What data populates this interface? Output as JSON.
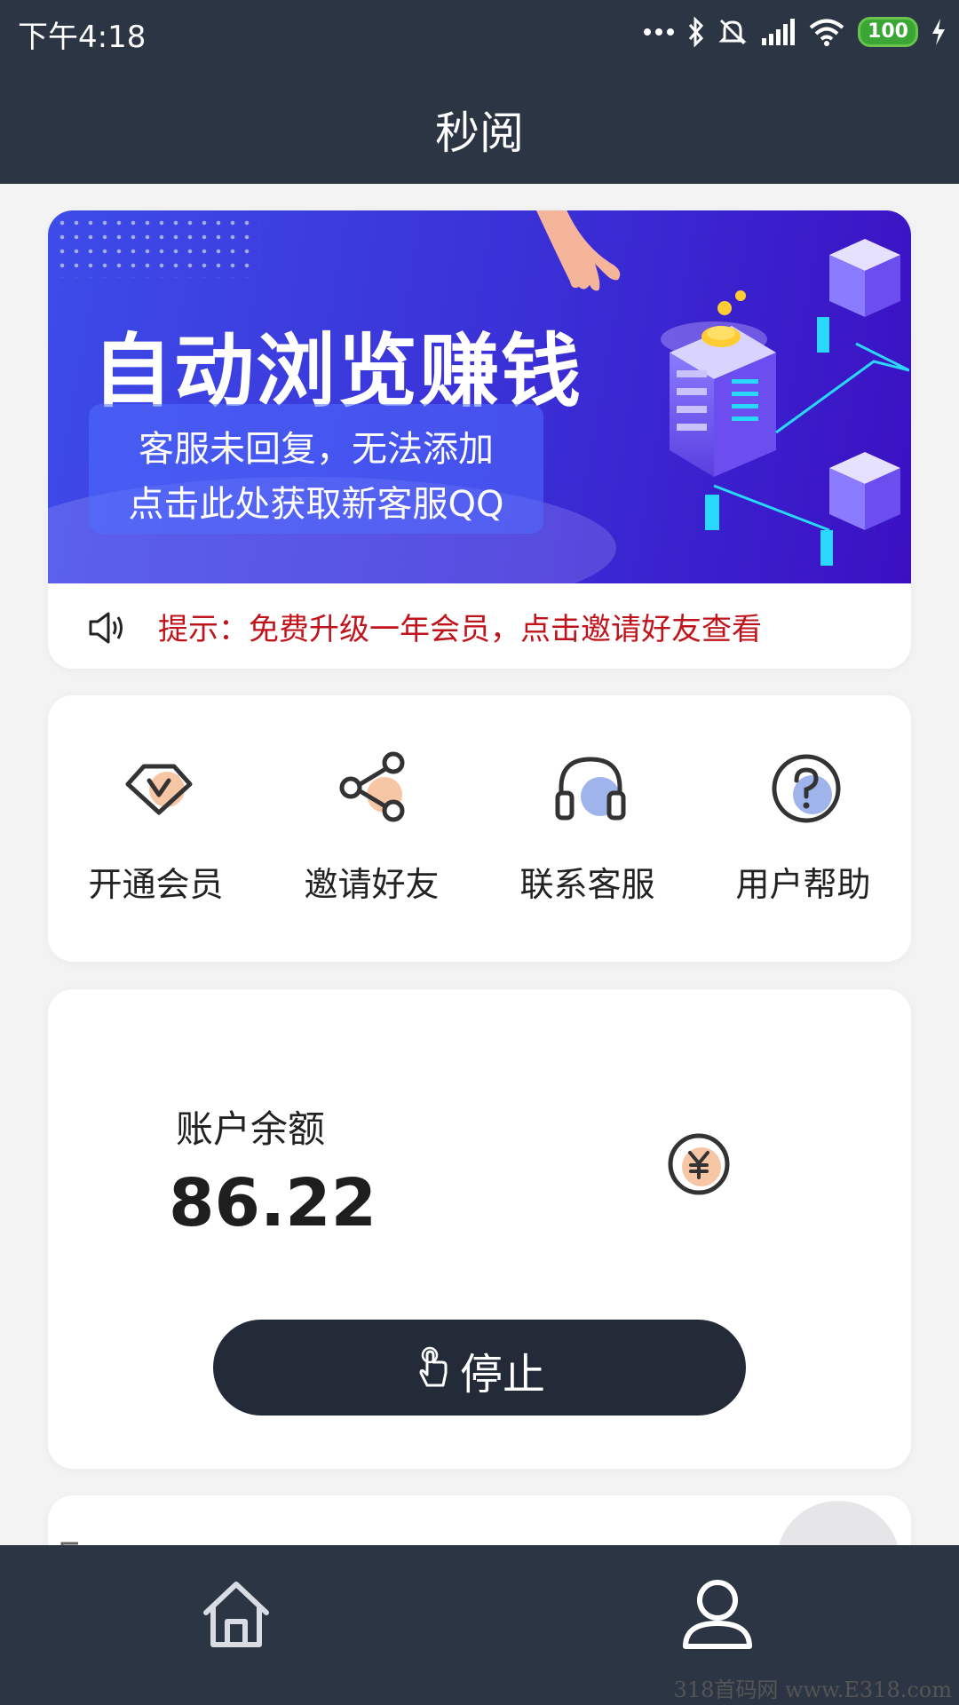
{
  "status_bar": {
    "time": "下午4:18",
    "battery": "100"
  },
  "header": {
    "title": "秒阅"
  },
  "banner": {
    "headline": "自动浏览赚钱",
    "line1": "客服未回复，无法添加",
    "line2": "点击此处获取新客服QQ"
  },
  "notice": {
    "text": "提示：免费升级一年会员，点击邀请好友查看"
  },
  "menu": {
    "items": [
      {
        "label": "开通会员",
        "icon": "vip-diamond-icon"
      },
      {
        "label": "邀请好友",
        "icon": "share-icon"
      },
      {
        "label": "联系客服",
        "icon": "headset-icon"
      },
      {
        "label": "用户帮助",
        "icon": "help-icon"
      }
    ]
  },
  "account": {
    "label": "账户余额",
    "balance": "86.22",
    "icon": "yuan-coin-icon"
  },
  "action": {
    "stop_label": "停止"
  },
  "bottom_nav": {
    "items": [
      {
        "icon": "home-icon"
      },
      {
        "icon": "profile-icon"
      }
    ]
  },
  "watermark": "318首码网 www.E318.com",
  "colors": {
    "dark": "#2b3544",
    "notice_red": "#c0141c",
    "accent_peach": "#f7c7a5",
    "accent_blue": "#9eb4ea"
  }
}
